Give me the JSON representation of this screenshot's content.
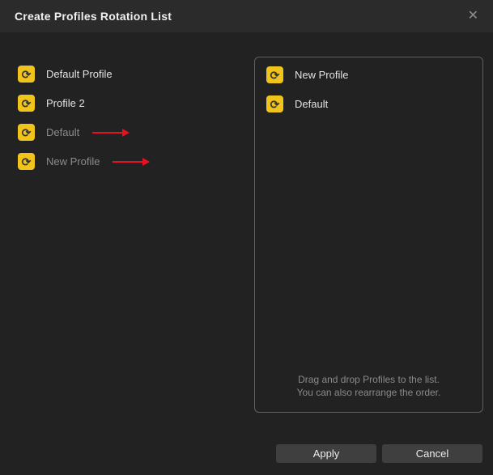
{
  "dialog": {
    "title": "Create Profiles Rotation List"
  },
  "icons": {
    "close": "✕",
    "rotate": "⟳"
  },
  "left_list": {
    "items": [
      {
        "label": "Default Profile",
        "muted": false,
        "arrow": false
      },
      {
        "label": "Profile 2",
        "muted": false,
        "arrow": false
      },
      {
        "label": "Default",
        "muted": true,
        "arrow": true
      },
      {
        "label": "New Profile",
        "muted": true,
        "arrow": true
      }
    ]
  },
  "rotation_list": {
    "items": [
      {
        "label": "New Profile"
      },
      {
        "label": "Default"
      }
    ],
    "hint_line1": "Drag and drop Profiles to the list.",
    "hint_line2": "You can also rearrange the order."
  },
  "buttons": {
    "apply": "Apply",
    "cancel": "Cancel"
  },
  "colors": {
    "titlebar_bg": "#2b2b2b",
    "dialog_bg": "#222222",
    "accent_yellow": "#f0c41b",
    "arrow_red": "#e81123",
    "panel_border": "#606060",
    "button_bg": "#3f3f3f",
    "text_primary": "#e3e3e3",
    "text_muted": "#8b8b8b"
  }
}
